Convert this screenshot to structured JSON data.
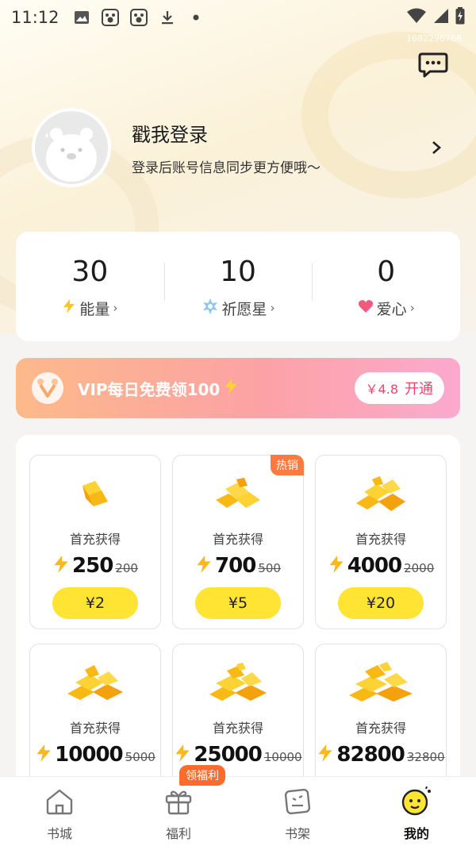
{
  "status_bar": {
    "time": "11:12",
    "left_icons": [
      "image-icon",
      "baidu-icon",
      "baidu-icon",
      "download-icon",
      "dot-icon"
    ],
    "right_icons": [
      "wifi-icon",
      "signal-icon",
      "battery-icon"
    ]
  },
  "watermark": "1682296768",
  "profile": {
    "login_title": "戳我登录",
    "login_subtitle": "登录后账号信息同步更方便哦～"
  },
  "stats": [
    {
      "value": "30",
      "label": "能量",
      "icon": "bolt-icon"
    },
    {
      "value": "10",
      "label": "祈愿星",
      "icon": "star-icon"
    },
    {
      "value": "0",
      "label": "爱心",
      "icon": "heart-icon"
    }
  ],
  "vip": {
    "text": "VIP每日免费领100",
    "button_price": "￥4.8",
    "button_label": "开通"
  },
  "packages": [
    {
      "desc": "首充获得",
      "amount": "250",
      "original": "200",
      "price": "¥2",
      "hot": ""
    },
    {
      "desc": "首充获得",
      "amount": "700",
      "original": "500",
      "price": "¥5",
      "hot": "热销"
    },
    {
      "desc": "首充获得",
      "amount": "4000",
      "original": "2000",
      "price": "¥20",
      "hot": ""
    },
    {
      "desc": "首充获得",
      "amount": "10000",
      "original": "5000",
      "price": "",
      "hot": ""
    },
    {
      "desc": "首充获得",
      "amount": "25000",
      "original": "10000",
      "price": "",
      "hot": ""
    },
    {
      "desc": "首充获得",
      "amount": "82800",
      "original": "32800",
      "price": "",
      "hot": ""
    }
  ],
  "nav": {
    "items": [
      {
        "label": "书城",
        "icon": "home-icon"
      },
      {
        "label": "福利",
        "icon": "gift-icon"
      },
      {
        "label": "书架",
        "icon": "bookshelf-icon"
      },
      {
        "label": "我的",
        "icon": "mascot-icon"
      }
    ],
    "badge": "领福利",
    "active": "我的"
  },
  "colors": {
    "accent_yellow": "#ffe433",
    "vip_pink": "#f2436b",
    "hot_orange": "#ff7a3d"
  }
}
